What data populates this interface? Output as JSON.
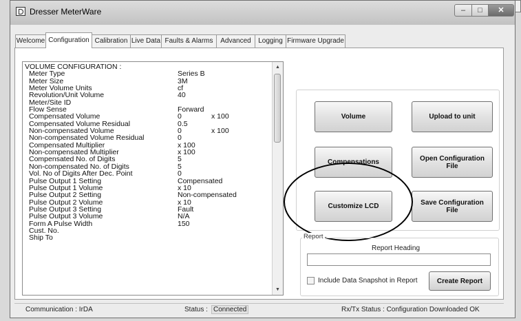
{
  "window": {
    "title": "Dresser MeterWare"
  },
  "tabs": [
    {
      "label": "Welcome"
    },
    {
      "label": "Configuration"
    },
    {
      "label": "Calibration"
    },
    {
      "label": "Live Data"
    },
    {
      "label": "Faults & Alarms"
    },
    {
      "label": "Advanced"
    },
    {
      "label": "Logging"
    },
    {
      "label": "Firmware Upgrade"
    }
  ],
  "config_list": {
    "header": "VOLUME CONFIGURATION :",
    "rows": [
      {
        "k": "Meter Type",
        "v": "Series B",
        "x": ""
      },
      {
        "k": "Meter Size",
        "v": "3M",
        "x": ""
      },
      {
        "k": "Meter Volume Units",
        "v": "cf",
        "x": ""
      },
      {
        "k": "Revolution/Unit Volume",
        "v": "40",
        "x": ""
      },
      {
        "k": "Meter/Site ID",
        "v": "",
        "x": ""
      },
      {
        "k": "Flow Sense",
        "v": "Forward",
        "x": ""
      },
      {
        "k": "Compensated Volume",
        "v": "0",
        "x": "x 100"
      },
      {
        "k": "Compensated Volume Residual",
        "v": "0.5",
        "x": ""
      },
      {
        "k": "Non-compensated Volume",
        "v": "0",
        "x": "x 100"
      },
      {
        "k": "Non-compensated Volume Residual",
        "v": "0",
        "x": ""
      },
      {
        "k": "Compensated Multiplier",
        "v": "x 100",
        "x": ""
      },
      {
        "k": "Non-compensated Multiplier",
        "v": "x 100",
        "x": ""
      },
      {
        "k": "Compensated No. of Digits",
        "v": "5",
        "x": ""
      },
      {
        "k": "Non-compensated No. of Digits",
        "v": "5",
        "x": ""
      },
      {
        "k": "Vol. No of Digits After Dec. Point",
        "v": "0",
        "x": ""
      },
      {
        "k": "Pulse Output 1 Setting",
        "v": "Compensated",
        "x": ""
      },
      {
        "k": "Pulse Output 1 Volume",
        "v": "x 10",
        "x": ""
      },
      {
        "k": "Pulse Output 2 Setting",
        "v": "Non-compensated",
        "x": ""
      },
      {
        "k": "Pulse Output 2 Volume",
        "v": "x 10",
        "x": ""
      },
      {
        "k": "Pulse Output 3 Setting",
        "v": "Fault",
        "x": ""
      },
      {
        "k": "Pulse Output 3 Volume",
        "v": "N/A",
        "x": ""
      },
      {
        "k": "Form A Pulse Width",
        "v": "150",
        "x": ""
      },
      {
        "k": "Cust. No.",
        "v": "",
        "x": ""
      },
      {
        "k": "Ship To",
        "v": "",
        "x": ""
      }
    ]
  },
  "buttons": {
    "volume": "Volume",
    "upload": "Upload to unit",
    "compensations": "Compensations",
    "open_config": "Open Configuration File",
    "customize_lcd": "Customize LCD",
    "save_config": "Save Configuration File",
    "create_report": "Create Report"
  },
  "report": {
    "legend": "Report",
    "heading_label": "Report Heading",
    "heading_value": "",
    "snapshot_label": "Include Data Snapshot in Report",
    "snapshot_checked": false
  },
  "status": {
    "communication": "Communication :  IrDA",
    "status_label": "Status :",
    "status_value": "Connected",
    "rxtx": "Rx/Tx Status :  Configuration Downloaded OK"
  },
  "colors": {
    "window_bg": "#ececec",
    "panel_bg": "#ffffff",
    "annotation": "#000000"
  }
}
